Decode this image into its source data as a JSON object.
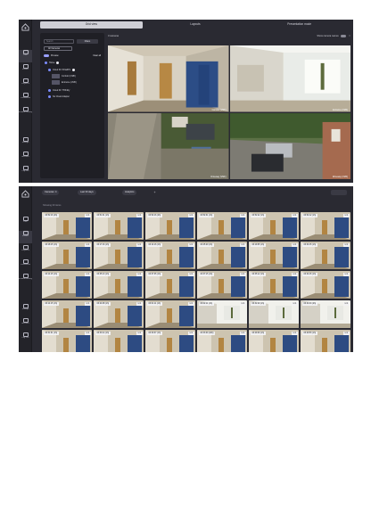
{
  "app": {
    "rail_top": [
      {
        "name": "live",
        "label": "Live",
        "icon": "monitor-icon"
      },
      {
        "name": "events",
        "label": "Events",
        "icon": "bolt-icon"
      },
      {
        "name": "playback",
        "label": "Playback",
        "icon": "play-icon"
      },
      {
        "name": "dashboard",
        "label": "Dashboard",
        "icon": "grid-icon"
      },
      {
        "name": "incident",
        "label": "Incident Manager",
        "icon": "alert-icon"
      }
    ],
    "rail_bottom": [
      {
        "name": "storage",
        "label": "Storage",
        "icon": "database-icon"
      },
      {
        "name": "account",
        "label": "Account",
        "icon": "user-icon"
      },
      {
        "name": "logout",
        "label": "Log Out",
        "icon": "logout-icon"
      }
    ]
  },
  "live": {
    "tabs": [
      {
        "label": "Grid view",
        "selected": true
      },
      {
        "label": "Layouts",
        "selected": false
      },
      {
        "label": "Presentation mode",
        "selected": false
      }
    ],
    "search_placeholder": "Search",
    "filters_label": "Filters",
    "all_cameras_label": "All Cameras",
    "preview_label": "Preview",
    "clear_all_label": "Clear all",
    "tree": [
      {
        "label": "Home",
        "level": 0,
        "kind": "site"
      },
      {
        "label": "Cloud ID: fO3aZPn",
        "level": 1,
        "kind": "device"
      },
      {
        "label": "Corridor (VMF)",
        "level": 2,
        "kind": "camera"
      },
      {
        "label": "Entrance (VMF)",
        "level": 2,
        "kind": "camera"
      },
      {
        "label": "Cloud ID: TH3nDy",
        "level": 1,
        "kind": "device"
      },
      {
        "label": "No Cloud Adapter",
        "level": 1,
        "kind": "device"
      }
    ],
    "camera_count_label": "3 cameras",
    "show_names_label": "Show camera names",
    "cameras": [
      {
        "name": "Corridor (VMF)"
      },
      {
        "name": "Entrance (VMF)"
      },
      {
        "name": "Driveway (VMF)"
      },
      {
        "name": "Driveway (VMF)"
      }
    ]
  },
  "events": {
    "chips": [
      "Cameras: 4",
      "Last 30 days",
      "Analytics"
    ],
    "showing_label": "Showing 30 items",
    "clips": [
      {
        "time": "06:52:16 (2h)",
        "count": "1",
        "scene": "corridor"
      },
      {
        "time": "06:51:31 (1h)",
        "count": "1",
        "scene": "corridor"
      },
      {
        "time": "06:52:16 (2h)",
        "count": "1",
        "scene": "corridor"
      },
      {
        "time": "06:52:31 (1h)",
        "count": "1",
        "scene": "corridor"
      },
      {
        "time": "06:52:22 (1h)",
        "count": "1",
        "scene": "corridor"
      },
      {
        "time": "06:52:12 (1h)",
        "count": "1",
        "scene": "corridor"
      },
      {
        "time": "06:18:15 (1h)",
        "count": "1",
        "scene": "corridor"
      },
      {
        "time": "06:17:16 (1h)",
        "count": "1",
        "scene": "corridor"
      },
      {
        "time": "06:14:16 (1h)",
        "count": "1",
        "scene": "corridor"
      },
      {
        "time": "06:45:29 (1h)",
        "count": "1",
        "scene": "corridor"
      },
      {
        "time": "06:19:05 (1h)",
        "count": "1",
        "scene": "corridor"
      },
      {
        "time": "06:32:15 (1h)",
        "count": "1",
        "scene": "corridor"
      },
      {
        "time": "06:14:15 (1h)",
        "count": "1",
        "scene": "corridor"
      },
      {
        "time": "06:35:13 (1h)",
        "count": "1",
        "scene": "corridor"
      },
      {
        "time": "06:37:35 (1h)",
        "count": "1",
        "scene": "corridor"
      },
      {
        "time": "06:37:15 (1h)",
        "count": "1",
        "scene": "corridor"
      },
      {
        "time": "06:35:12 (1h)",
        "count": "1",
        "scene": "corridor"
      },
      {
        "time": "06:32:15 (1h)",
        "count": "1",
        "scene": "corridor"
      },
      {
        "time": "06:14:15 (1h)",
        "count": "1",
        "scene": "corridor"
      },
      {
        "time": "06:24:08 (1h)",
        "count": "1",
        "scene": "corridor"
      },
      {
        "time": "06:01:11 (1h)",
        "count": "1",
        "scene": "corridor"
      },
      {
        "time": "06:02:11 (1h)",
        "count": "1",
        "scene": "entrance"
      },
      {
        "time": "06:32:29 (1h)",
        "count": "1",
        "scene": "entrance"
      },
      {
        "time": "06:32:23 (2h)",
        "count": "1",
        "scene": "entrance"
      },
      {
        "time": "06:31:31 (1h)",
        "count": "1",
        "scene": "corridor"
      },
      {
        "time": "06:30:14 (1h)",
        "count": "1",
        "scene": "corridor"
      },
      {
        "time": "06:30:37 (1h)",
        "count": "1",
        "scene": "corridor"
      },
      {
        "time": "06:33:09 (20h)",
        "count": "1",
        "scene": "corridor"
      },
      {
        "time": "06:29:09 (1h)",
        "count": "1",
        "scene": "corridor"
      },
      {
        "time": "06:29:53 (1h)",
        "count": "1",
        "scene": "corridor"
      }
    ]
  }
}
